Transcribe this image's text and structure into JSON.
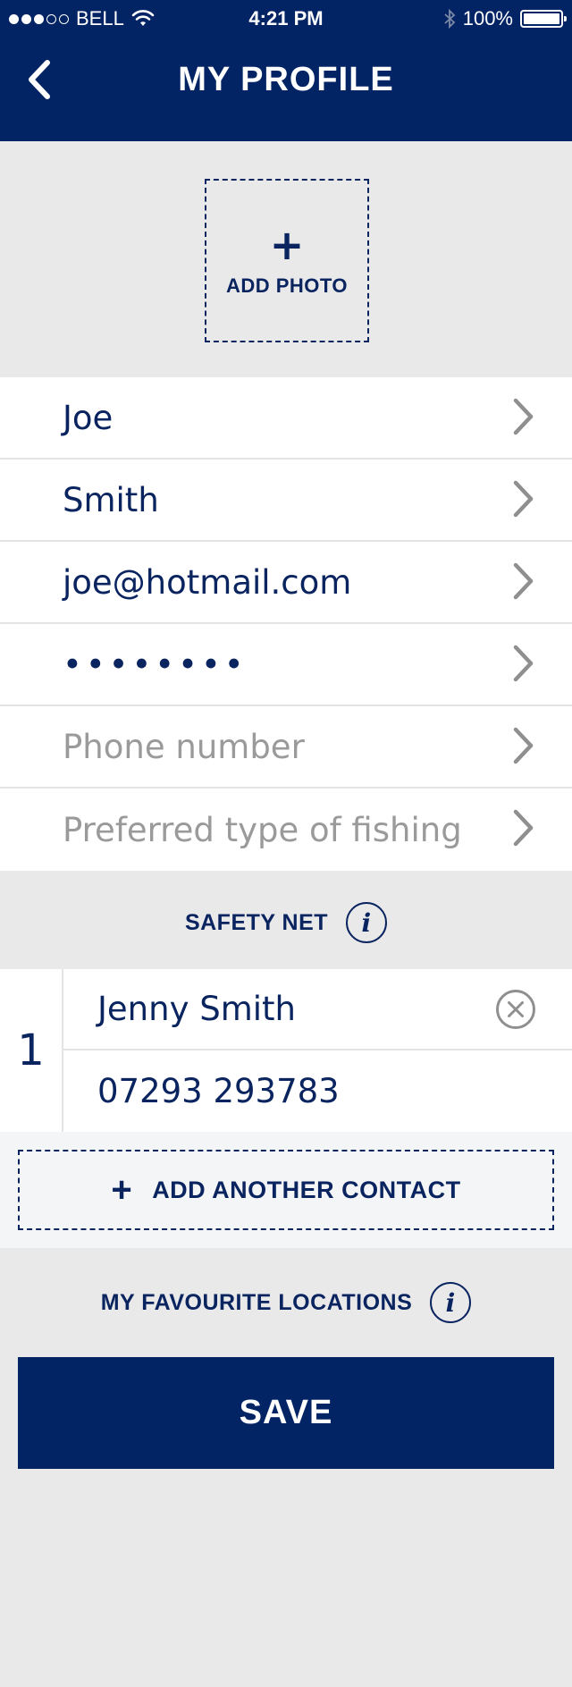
{
  "status_bar": {
    "carrier": "BELL",
    "time": "4:21 PM",
    "battery": "100%",
    "signal_bars_filled": 3,
    "signal_bars_total": 5
  },
  "header": {
    "title": "MY PROFILE",
    "back_icon": "chevron-left-icon"
  },
  "photo": {
    "label": "ADD PHOTO",
    "plus": "+"
  },
  "fields": [
    {
      "name": "first-name",
      "value": "Joe",
      "placeholder": false
    },
    {
      "name": "last-name",
      "value": "Smith",
      "placeholder": false
    },
    {
      "name": "email",
      "value": "joe@hotmail.com",
      "placeholder": false
    },
    {
      "name": "password",
      "value": "••••••••",
      "placeholder": false
    },
    {
      "name": "phone",
      "value": "Phone number",
      "placeholder": true
    },
    {
      "name": "fishing-type",
      "value": "Preferred type of fishing",
      "placeholder": true
    }
  ],
  "safety_net": {
    "title": "SAFETY NET",
    "info_icon": "i",
    "contacts": [
      {
        "index": "1",
        "name": "Jenny Smith",
        "phone": "07293 293783"
      }
    ],
    "add_label": "ADD ANOTHER CONTACT",
    "add_plus": "+"
  },
  "favourites": {
    "title": "MY FAVOURITE LOCATIONS",
    "info_icon": "i"
  },
  "save_label": "SAVE",
  "colors": {
    "brand_navy": "#032464",
    "text_navy": "#0a2460",
    "background": "#e9e9ea",
    "placeholder": "#9a9a9a",
    "chevron": "#8f8f8f"
  }
}
